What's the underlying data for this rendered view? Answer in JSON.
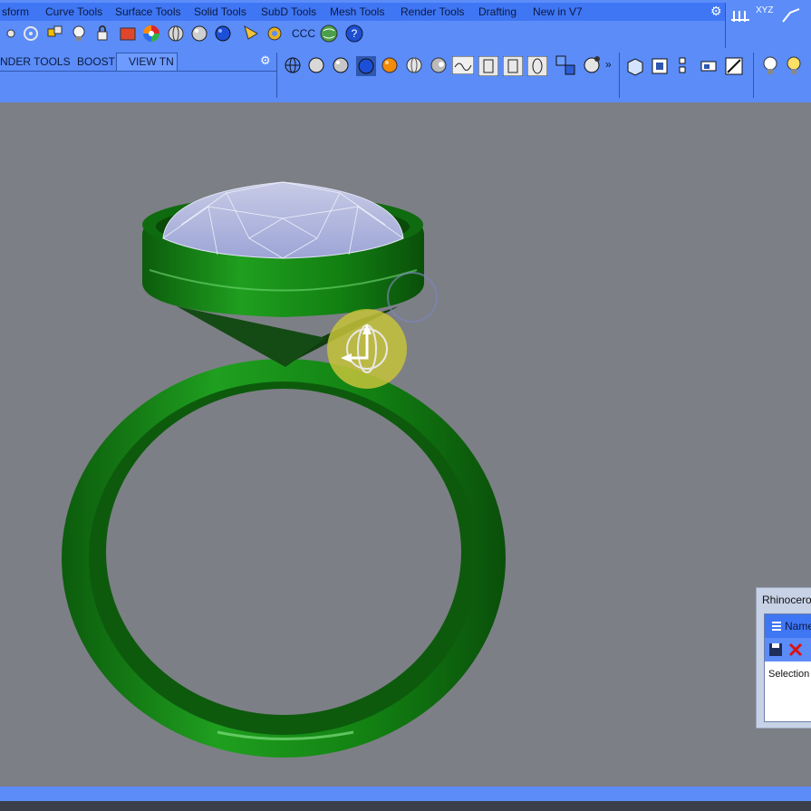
{
  "menu": {
    "tabs": [
      "sform",
      "Curve Tools",
      "Surface Tools",
      "Solid Tools",
      "SubD Tools",
      "Mesh Tools",
      "Render Tools",
      "Drafting",
      "New in V7"
    ]
  },
  "toolbar": {
    "ccc_label": "CCC",
    "xyz_label": "XYZ"
  },
  "tabs": [
    "NDER TOOLS",
    "BOOST",
    "VIEW TN"
  ],
  "panel": {
    "title": "Rhinoceros",
    "tab_label": "Name",
    "selection_label": "Selection"
  },
  "colors": {
    "toolbar_bg": "#5b8cf8",
    "menu_bg": "#3f76f4",
    "viewport_bg": "#7d7f86",
    "ring_green": "#138a12",
    "gizmo_yellow": "#c6c33a"
  }
}
